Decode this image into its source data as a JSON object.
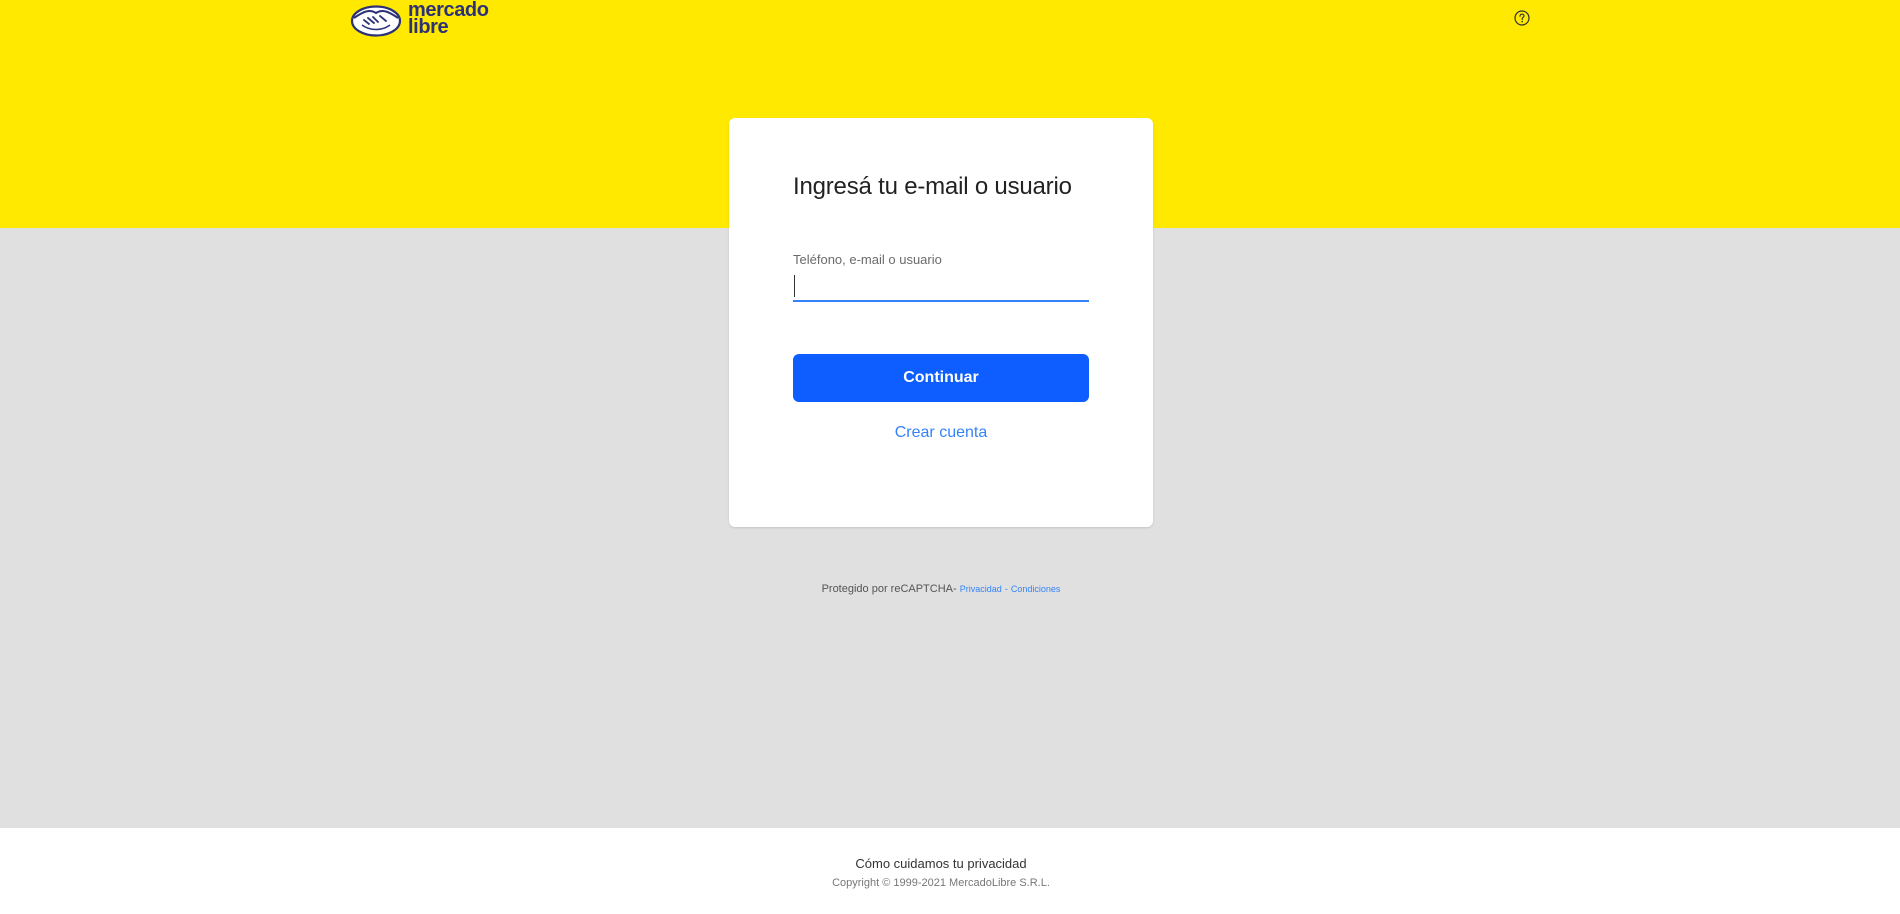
{
  "brand": {
    "name_line1": "mercado",
    "name_line2": "libre",
    "logo_icon": "handshake-icon",
    "colors": {
      "yellow": "#ffe900",
      "blue": "#3483fa",
      "button_blue": "#0d5dff",
      "navy": "#2d3277"
    }
  },
  "header": {
    "help_icon": "question-circle-icon"
  },
  "login": {
    "title": "Ingresá tu e-mail o usuario",
    "field_label": "Teléfono, e-mail o usuario",
    "field_value": "",
    "continue_label": "Continuar",
    "create_account_label": "Crear cuenta"
  },
  "recaptcha": {
    "text": "Protegido por reCAPTCHA-",
    "privacy_label": "Privacidad",
    "separator": "-",
    "terms_label": "Condiciones"
  },
  "footer": {
    "privacy_link": "Cómo cuidamos tu privacidad",
    "copyright": "Copyright © 1999-2021 MercadoLibre S.R.L."
  }
}
